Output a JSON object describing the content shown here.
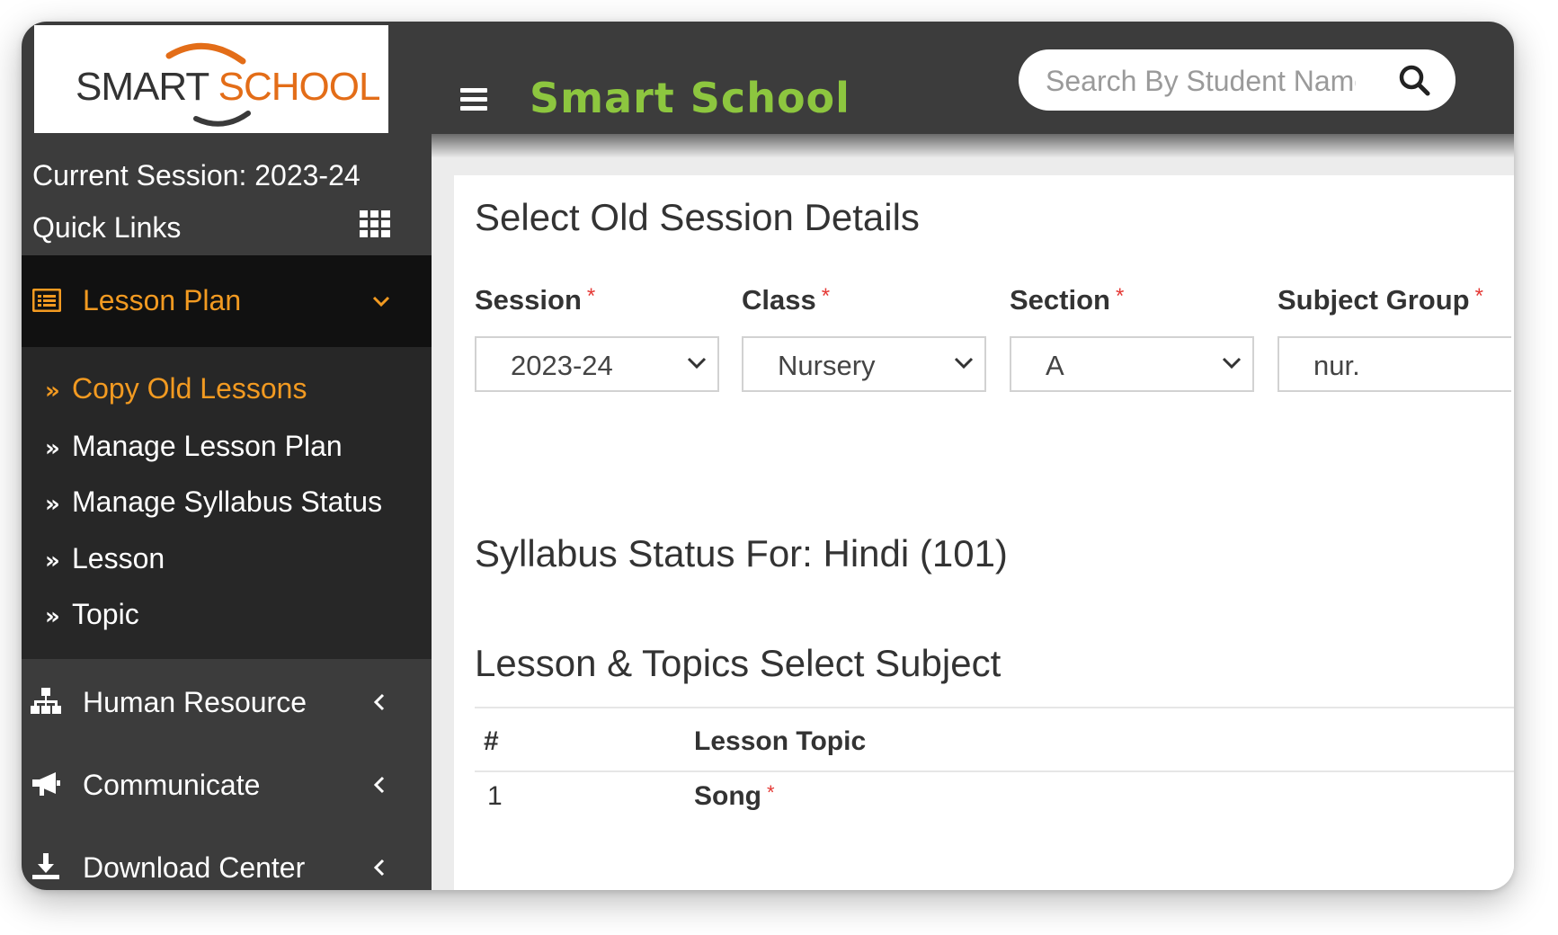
{
  "app": {
    "logo_smart": "SMART",
    "logo_school": "SCHOOL",
    "title": "Smart School",
    "search_placeholder": "Search By Student Name"
  },
  "sidebar": {
    "current_session": "Current Session: 2023-24",
    "quick_links": "Quick Links",
    "active_menu": {
      "label": "Lesson Plan",
      "icon": "lesson-plan-icon"
    },
    "submenu": [
      {
        "label": "Copy Old Lessons",
        "active": true
      },
      {
        "label": "Manage Lesson Plan",
        "active": false
      },
      {
        "label": "Manage Syllabus Status",
        "active": false
      },
      {
        "label": "Lesson",
        "active": false
      },
      {
        "label": "Topic",
        "active": false
      }
    ],
    "menu": [
      {
        "label": "Human Resource",
        "icon": "sitemap-icon"
      },
      {
        "label": "Communicate",
        "icon": "bullhorn-icon"
      },
      {
        "label": "Download Center",
        "icon": "download-icon"
      }
    ]
  },
  "main": {
    "heading": "Select Old Session Details",
    "fields": [
      {
        "label": "Session",
        "value": "2023-24"
      },
      {
        "label": "Class",
        "value": "Nursery"
      },
      {
        "label": "Section",
        "value": "A"
      },
      {
        "label": "Subject Group",
        "value": "nur."
      }
    ],
    "required_mark": "*",
    "syllabus_heading": "Syllabus Status For: Hindi (101)",
    "lesson_heading": "Lesson & Topics Select Subject",
    "table": {
      "headers": [
        "#",
        "Lesson Topic"
      ],
      "rows": [
        {
          "num": "1",
          "lesson": "Song"
        }
      ]
    }
  },
  "colors": {
    "header_bg": "#3c3c3c",
    "title_green": "#8dc63f",
    "accent_orange": "#f29a21",
    "required_red": "#e53935"
  }
}
